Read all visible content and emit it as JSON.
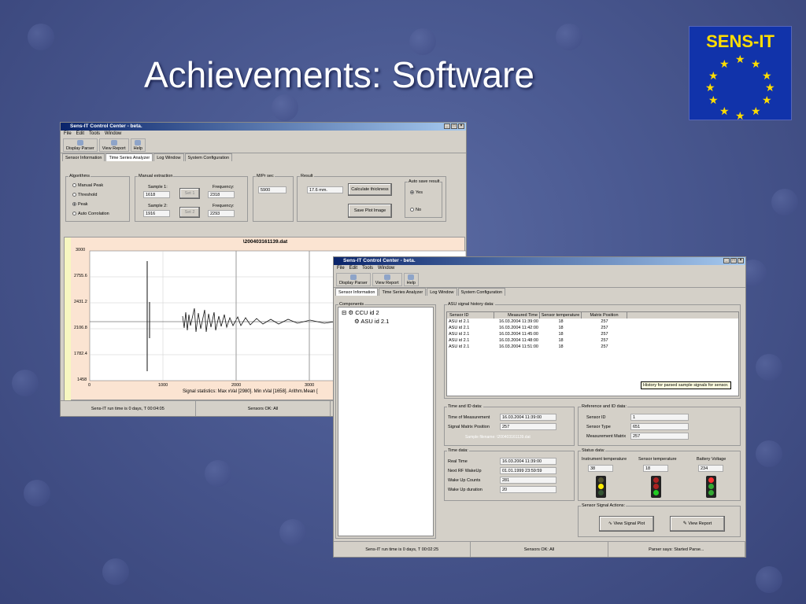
{
  "slide": {
    "title": "Achievements: Software",
    "logo": "SENS-IT"
  },
  "w1": {
    "title": "Sens-IT Control Center - beta.",
    "menu": [
      "File",
      "Edit",
      "Tools",
      "Window"
    ],
    "toolbar": [
      "Display Parser",
      "View Report",
      "Help"
    ],
    "tabs": [
      "Sensor Information",
      "Time Series Analyzer",
      "Log Window",
      "System Configuration"
    ],
    "algorithms": {
      "label": "Algorithms",
      "options": [
        "Manual Peak",
        "Threshold",
        "Peak",
        "Auto Corrolation"
      ],
      "selected": 2
    },
    "manual": {
      "label": "Manual extraction",
      "sample1_label": "Sample 1:",
      "sample1": "1618",
      "sample2_label": "Sample 2:",
      "sample2": "1916",
      "set1": "Set 1",
      "set2": "Set 2",
      "freq_label": "Frequency:",
      "freq1": "2318",
      "freq2": "2293"
    },
    "mps": {
      "label": "M/Pr sec",
      "value": "5900"
    },
    "result": {
      "label": "Result",
      "value": "17.6 mm.",
      "calc": "Calculate thickness",
      "save": "Save Plot Image"
    },
    "autosave": {
      "label": "Auto save result",
      "yes": "Yes",
      "no": "No"
    },
    "plot": {
      "file": "\\200403161139.dat",
      "yticks": [
        "3000",
        "2755.6",
        "2431.2",
        "2106.8",
        "1782.4",
        "1458"
      ],
      "xticks": [
        "0",
        "1000",
        "2000",
        "3000"
      ],
      "stats": "Signal statistics:  Max xVal [2980].  Min xVal [1658].  Arithm.Mean ["
    },
    "status": [
      "Sens-IT run time is 0 days, T 00:04:05",
      "Sensors OK: All",
      ""
    ]
  },
  "w2": {
    "title": "Sens-IT Control Center - beta.",
    "menu": [
      "File",
      "Edit",
      "Tools",
      "Window"
    ],
    "toolbar": [
      "Display Parser",
      "View Report",
      "Help"
    ],
    "tabs": [
      "Sensor Information",
      "Time Series Analyzer",
      "Log Window",
      "System Configuration"
    ],
    "components": {
      "label": "Components",
      "nodes": [
        "CCU id 2",
        "ASU id 2.1"
      ]
    },
    "history": {
      "label": "ASU signal history data:",
      "headers": [
        "Sensor ID",
        "Measured Time",
        "Sensor temperature",
        "Matrix Position"
      ],
      "rows": [
        [
          "ASU id 2.1",
          "16.03.2004 11:39:00",
          "18",
          "257"
        ],
        [
          "ASU id 2.1",
          "16.03.2004 11:42:00",
          "18",
          "257"
        ],
        [
          "ASU id 2.1",
          "16.03.2004 11:45:00",
          "18",
          "257"
        ],
        [
          "ASU id 2.1",
          "16.03.2004 11:48:00",
          "18",
          "257"
        ],
        [
          "ASU id 2.1",
          "16.03.2004 11:51:00",
          "18",
          "257"
        ]
      ],
      "tooltip": "History for parsed sample signals for sensor."
    },
    "timeid": {
      "label": "Time and ID data:",
      "t_label": "Time of Measurement",
      "t": "16.03.2004 11:39:00",
      "p_label": "Signal Matrix Position",
      "p": "257",
      "file": "Sample filename: \\200403161139.dat"
    },
    "ref": {
      "label": "Reference and ID data:",
      "id_label": "Sensor ID",
      "id": "1",
      "type_label": "Sensor Type",
      "type": "651",
      "mm_label": "Measurement Matrix",
      "mm": "257"
    },
    "time": {
      "label": "Time data:",
      "rows": [
        [
          "Real Time",
          "16.03.2004 11:39:00"
        ],
        [
          "Next RF WakeUp",
          "01.01.1999 23:59:59"
        ],
        [
          "Wake Up Counts",
          "281"
        ],
        [
          "Wake Up duration",
          "20"
        ]
      ]
    },
    "statusdata": {
      "label": "Status data:",
      "cols": [
        "Instrument temperature",
        "Sensor temperature",
        "Battery Voltage"
      ],
      "vals": [
        "38",
        "18",
        "234"
      ]
    },
    "actions": {
      "label": "Sensor Signal Actions:",
      "signal": "View Signal Plot",
      "report": "View Report"
    },
    "status": [
      "Sens-IT run time is 0 days, T 00:02:25",
      "Sensors OK: All",
      "Parser says: Started Parse..."
    ]
  },
  "colors": {
    "slide_bg": "#4b5a92",
    "logo_bg": "#1133aa",
    "logo_star": "#ffdd00",
    "titlebar": "#0a246a"
  }
}
